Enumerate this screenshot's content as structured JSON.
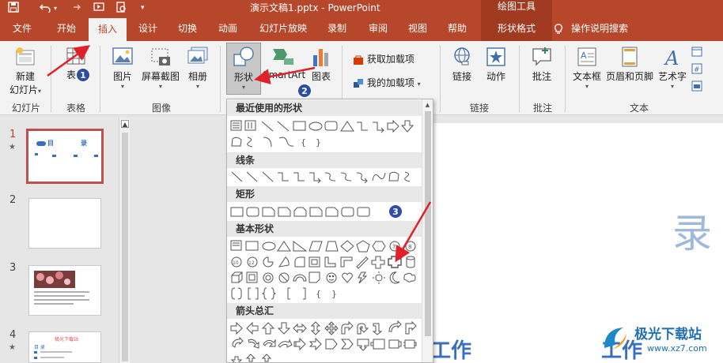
{
  "window": {
    "title": "演示文稿1.pptx  -  PowerPoint",
    "context_group": "绘图工具"
  },
  "tabs": [
    {
      "label": "文件"
    },
    {
      "label": "开始"
    },
    {
      "label": "插入"
    },
    {
      "label": "设计"
    },
    {
      "label": "切换"
    },
    {
      "label": "动画"
    },
    {
      "label": "幻灯片放映"
    },
    {
      "label": "录制"
    },
    {
      "label": "审阅"
    },
    {
      "label": "视图"
    },
    {
      "label": "帮助"
    },
    {
      "label": "形状格式"
    }
  ],
  "search_hint": "操作说明搜索",
  "ribbon": {
    "new_slide_line1": "新建",
    "new_slide_line2": "幻灯片",
    "table": "表格",
    "picture": "图片",
    "screenshot": "屏幕截图",
    "album": "相册",
    "shapes": "形状",
    "smartart": "SmartArt",
    "chart": "图表",
    "get_addins": "获取加载项",
    "my_addins": "我的加载项",
    "link": "链接",
    "action": "动作",
    "comment": "批注",
    "textbox": "文本框",
    "header_footer": "页眉和页脚",
    "wordart": "艺术字",
    "groups": {
      "slides": "幻灯片",
      "tables": "表格",
      "images": "图像",
      "links": "链接",
      "comments": "批注",
      "text": "文本"
    }
  },
  "shapes_menu": {
    "categories": [
      "最近使用的形状",
      "线条",
      "矩形",
      "基本形状",
      "箭头总汇"
    ]
  },
  "slides": [
    {
      "number": "1",
      "title_a": "目",
      "title_b": "录"
    },
    {
      "number": "2"
    },
    {
      "number": "3"
    },
    {
      "number": "4",
      "title_a": "极光下载站",
      "title_b": "目 录"
    }
  ],
  "canvas": {
    "big_char": "录",
    "bottom_text_a": "工作",
    "bottom_text_b": "工作"
  },
  "badges": [
    "1",
    "2",
    "3"
  ],
  "watermark": {
    "name": "极光下载站",
    "url": "www.xz7.com"
  },
  "colors": {
    "accent": "#b7472a",
    "badge": "#2b4ea2",
    "arrow": "#e0202a"
  }
}
